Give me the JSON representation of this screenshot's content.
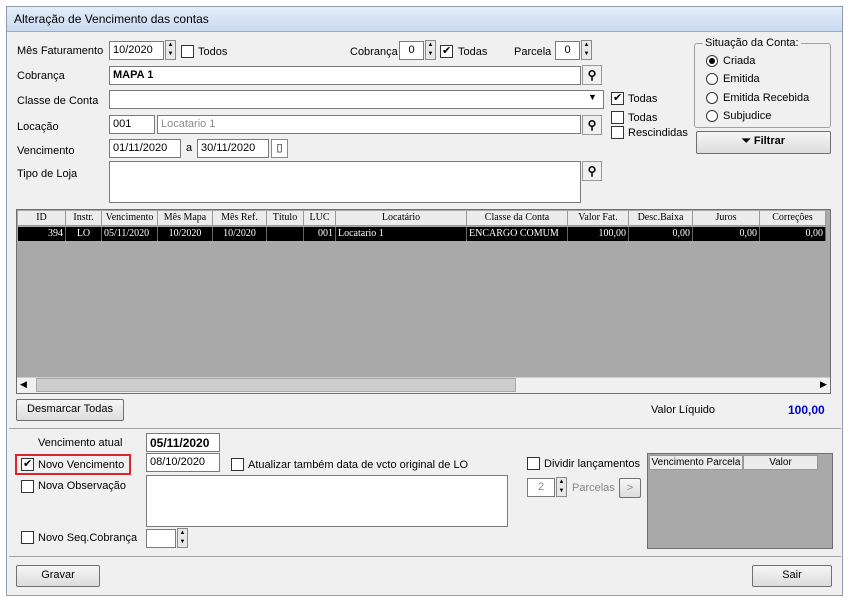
{
  "window": {
    "title": "Alteração de Vencimento das contas"
  },
  "filters": {
    "mes_faturamento_label": "Mês Faturamento",
    "mes_faturamento_value": "10/2020",
    "todos_label": "Todos",
    "cobranca_num_label": "Cobrança",
    "cobranca_num_value": "0",
    "todas_label": "Todas",
    "parcela_label": "Parcela",
    "parcela_value": "0",
    "cobranca_label": "Cobrança",
    "cobranca_value": "MAPA 1",
    "classe_label": "Classe de Conta",
    "classe_value": "",
    "classe_todas_label": "Todas",
    "locacao_label": "Locação",
    "locacao_code": "001",
    "locacao_name": "Locatario 1",
    "locacao_todas_label": "Todas",
    "rescindidas_label": "Rescindidas",
    "vencimento_label": "Vencimento",
    "venc_from": "01/11/2020",
    "venc_a": "a",
    "venc_to": "30/11/2020",
    "tipo_loja_label": "Tipo de Loja"
  },
  "situacao": {
    "title": "Situação da Conta:",
    "options": [
      "Criada",
      "Emitida",
      "Emitida Recebida",
      "Subjudice"
    ],
    "selected": "Criada",
    "filtrar_label": "Filtrar"
  },
  "grid": {
    "columns": [
      "ID",
      "Instr.",
      "Vencimento",
      "Mês Mapa",
      "Mês Ref.",
      "Título",
      "LUC",
      "Locatário",
      "Classe da Conta",
      "Valor Fat.",
      "Desc.Baixa",
      "Juros",
      "Correções"
    ],
    "rows": [
      [
        "394",
        "LO",
        "05/11/2020",
        "10/2020",
        "10/2020",
        "",
        "001",
        "Locatario 1",
        "ENCARGO COMUM",
        "100,00",
        "0,00",
        "0,00",
        "0,00"
      ]
    ]
  },
  "footer": {
    "desmarcar_label": "Desmarcar Todas",
    "valor_liquido_label": "Valor Líquido",
    "valor_liquido_value": "100,00"
  },
  "edit": {
    "vencimento_atual_label": "Vencimento atual",
    "vencimento_atual_value": "05/11/2020",
    "novo_vencimento_label": "Novo Vencimento",
    "novo_vencimento_value": "08/10/2020",
    "atualizar_label": "Atualizar também data de vcto original de LO",
    "nova_observacao_label": "Nova Observação",
    "novo_seq_label": "Novo Seq.Cobrança",
    "dividir_label": "Dividir lançamentos",
    "parcelas_value": "2",
    "parcelas_label": "Parcelas",
    "next_label": ">",
    "parcel_columns": [
      "Vencimento Parcela",
      "Valor"
    ]
  },
  "actions": {
    "gravar_label": "Gravar",
    "sair_label": "Sair"
  },
  "colors": {
    "accent_blue": "#0000cc",
    "highlight_border": "#d9262c",
    "row_selected": "#000000"
  }
}
